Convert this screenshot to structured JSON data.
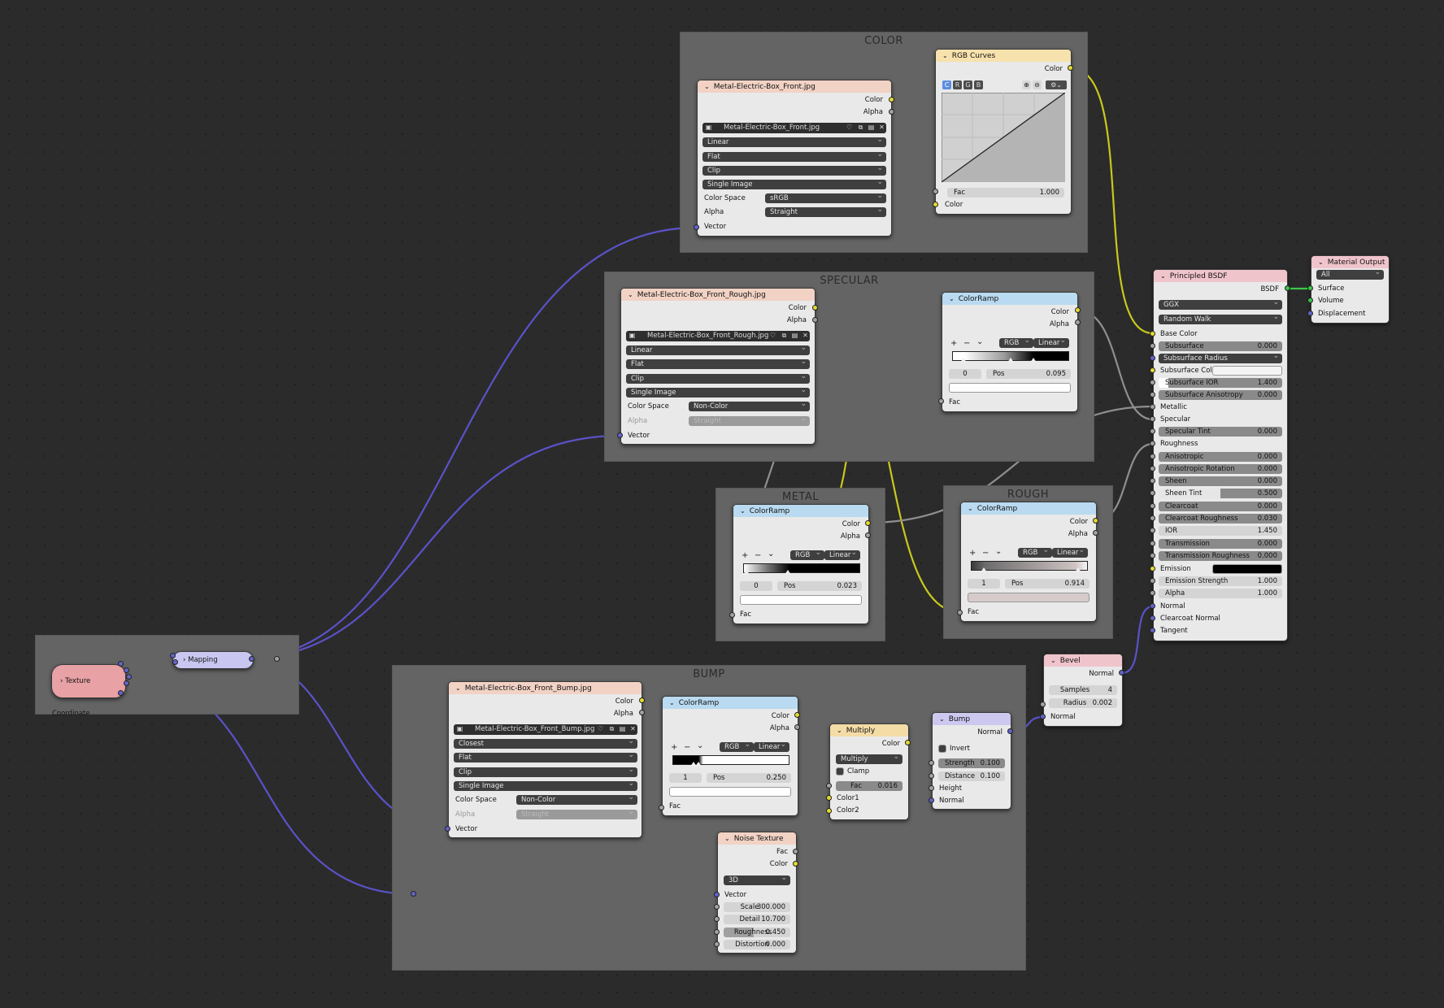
{
  "frames": {
    "color": "COLOR",
    "specular": "SPECULAR",
    "metal": "METAL",
    "rough": "ROUGH",
    "bump": "BUMP"
  },
  "tex_color": {
    "title": "Metal-Electric-Box_Front.jpg",
    "out_color": "Color",
    "out_alpha": "Alpha",
    "image_name": "Metal-Electric-Box_Front.jpg",
    "interpolation": "Linear",
    "projection": "Flat",
    "extension": "Clip",
    "source": "Single Image",
    "color_space_label": "Color Space",
    "color_space": "sRGB",
    "alpha_label": "Alpha",
    "alpha_mode": "Straight",
    "in_vector": "Vector"
  },
  "rgb_curves": {
    "title": "RGB Curves",
    "out_color": "Color",
    "channels": [
      "C",
      "R",
      "G",
      "B"
    ],
    "fac_label": "Fac",
    "fac_value": "1.000",
    "in_color": "Color"
  },
  "tex_rough": {
    "title": "Metal-Electric-Box_Front_Rough.jpg",
    "out_color": "Color",
    "out_alpha": "Alpha",
    "image_name": "Metal-Electric-Box_Front_Rough.jpg",
    "interpolation": "Linear",
    "projection": "Flat",
    "extension": "Clip",
    "source": "Single Image",
    "color_space_label": "Color Space",
    "color_space": "Non-Color",
    "alpha_label": "Alpha",
    "alpha_mode": "Straight",
    "in_vector": "Vector"
  },
  "ramp_spec": {
    "title": "ColorRamp",
    "out_color": "Color",
    "out_alpha": "Alpha",
    "mode": "RGB",
    "interp": "Linear",
    "index": "0",
    "pos_label": "Pos",
    "pos": "0.095",
    "in_fac": "Fac"
  },
  "ramp_metal": {
    "title": "ColorRamp",
    "out_color": "Color",
    "out_alpha": "Alpha",
    "mode": "RGB",
    "interp": "Linear",
    "index": "0",
    "pos_label": "Pos",
    "pos": "0.023",
    "in_fac": "Fac"
  },
  "ramp_rough": {
    "title": "ColorRamp",
    "out_color": "Color",
    "out_alpha": "Alpha",
    "mode": "RGB",
    "interp": "Linear",
    "index": "1",
    "pos_label": "Pos",
    "pos": "0.914",
    "in_fac": "Fac"
  },
  "tex_bump": {
    "title": "Metal-Electric-Box_Front_Bump.jpg",
    "out_color": "Color",
    "out_alpha": "Alpha",
    "image_name": "Metal-Electric-Box_Front_Bump.jpg",
    "interpolation": "Closest",
    "projection": "Flat",
    "extension": "Clip",
    "source": "Single Image",
    "color_space_label": "Color Space",
    "color_space": "Non-Color",
    "alpha_label": "Alpha",
    "alpha_mode": "Straight",
    "in_vector": "Vector"
  },
  "ramp_bump": {
    "title": "ColorRamp",
    "out_color": "Color",
    "out_alpha": "Alpha",
    "mode": "RGB",
    "interp": "Linear",
    "index": "1",
    "pos_label": "Pos",
    "pos": "0.250",
    "in_fac": "Fac"
  },
  "multiply": {
    "title": "Multiply",
    "out_color": "Color",
    "blend": "Multiply",
    "clamp": "Clamp",
    "fac_label": "Fac",
    "fac": "0.016",
    "in_color1": "Color1",
    "in_color2": "Color2"
  },
  "noise": {
    "title": "Noise Texture",
    "out_fac": "Fac",
    "out_color": "Color",
    "dims": "3D",
    "in_vector": "Vector",
    "fields": [
      {
        "label": "Scale",
        "value": "300.000"
      },
      {
        "label": "Detail",
        "value": "10.700"
      },
      {
        "label": "Roughness",
        "value": "0.450"
      },
      {
        "label": "Distortion",
        "value": "0.000"
      }
    ]
  },
  "bump": {
    "title": "Bump",
    "out_normal": "Normal",
    "invert": "Invert",
    "strength_label": "Strength",
    "strength": "0.100",
    "distance_label": "Distance",
    "distance": "0.100",
    "in_height": "Height",
    "in_normal": "Normal"
  },
  "bevel": {
    "title": "Bevel",
    "out_normal": "Normal",
    "samples_label": "Samples",
    "samples": "4",
    "radius_label": "Radius",
    "radius": "0.002",
    "in_normal": "Normal"
  },
  "texcoord": {
    "title": "Texture Coordinate"
  },
  "mapping": {
    "title": "Mapping"
  },
  "bsdf": {
    "title": "Principled BSDF",
    "out_bsdf": "BSDF",
    "distribution": "GGX",
    "subsurface_method": "Random Walk",
    "base_color": "Base Color",
    "subsurface_label": "Subsurface",
    "subsurface": "0.000",
    "subsurface_radius": "Subsurface Radius",
    "subsurface_color": "Subsurface Color",
    "subsurface_ior_label": "Subsurface IOR",
    "subsurface_ior": "1.400",
    "subsurface_aniso_label": "Subsurface Anisotropy",
    "subsurface_aniso": "0.000",
    "metallic": "Metallic",
    "specular": "Specular",
    "specular_tint_label": "Specular Tint",
    "specular_tint": "0.000",
    "roughness": "Roughness",
    "anisotropic_label": "Anisotropic",
    "anisotropic": "0.000",
    "aniso_rot_label": "Anisotropic Rotation",
    "aniso_rot": "0.000",
    "sheen_label": "Sheen",
    "sheen": "0.000",
    "sheen_tint_label": "Sheen Tint",
    "sheen_tint": "0.500",
    "clearcoat_label": "Clearcoat",
    "clearcoat": "0.000",
    "clearcoat_rough_label": "Clearcoat Roughness",
    "clearcoat_rough": "0.030",
    "ior_label": "IOR",
    "ior": "1.450",
    "transmission_label": "Transmission",
    "transmission": "0.000",
    "trans_rough_label": "Transmission Roughness",
    "trans_rough": "0.000",
    "emission": "Emission",
    "emission_strength_label": "Emission Strength",
    "emission_strength": "1.000",
    "alpha_label": "Alpha",
    "alpha": "1.000",
    "normal": "Normal",
    "clearcoat_normal": "Clearcoat Normal",
    "tangent": "Tangent"
  },
  "output": {
    "title": "Material Output",
    "target": "All",
    "surface": "Surface",
    "volume": "Volume",
    "displacement": "Displacement"
  },
  "colors": {
    "yellow_link": "#c8c81e",
    "grey_link": "#9a9a9a",
    "purple_link": "#5a52c8",
    "green_link": "#3cc84b"
  }
}
